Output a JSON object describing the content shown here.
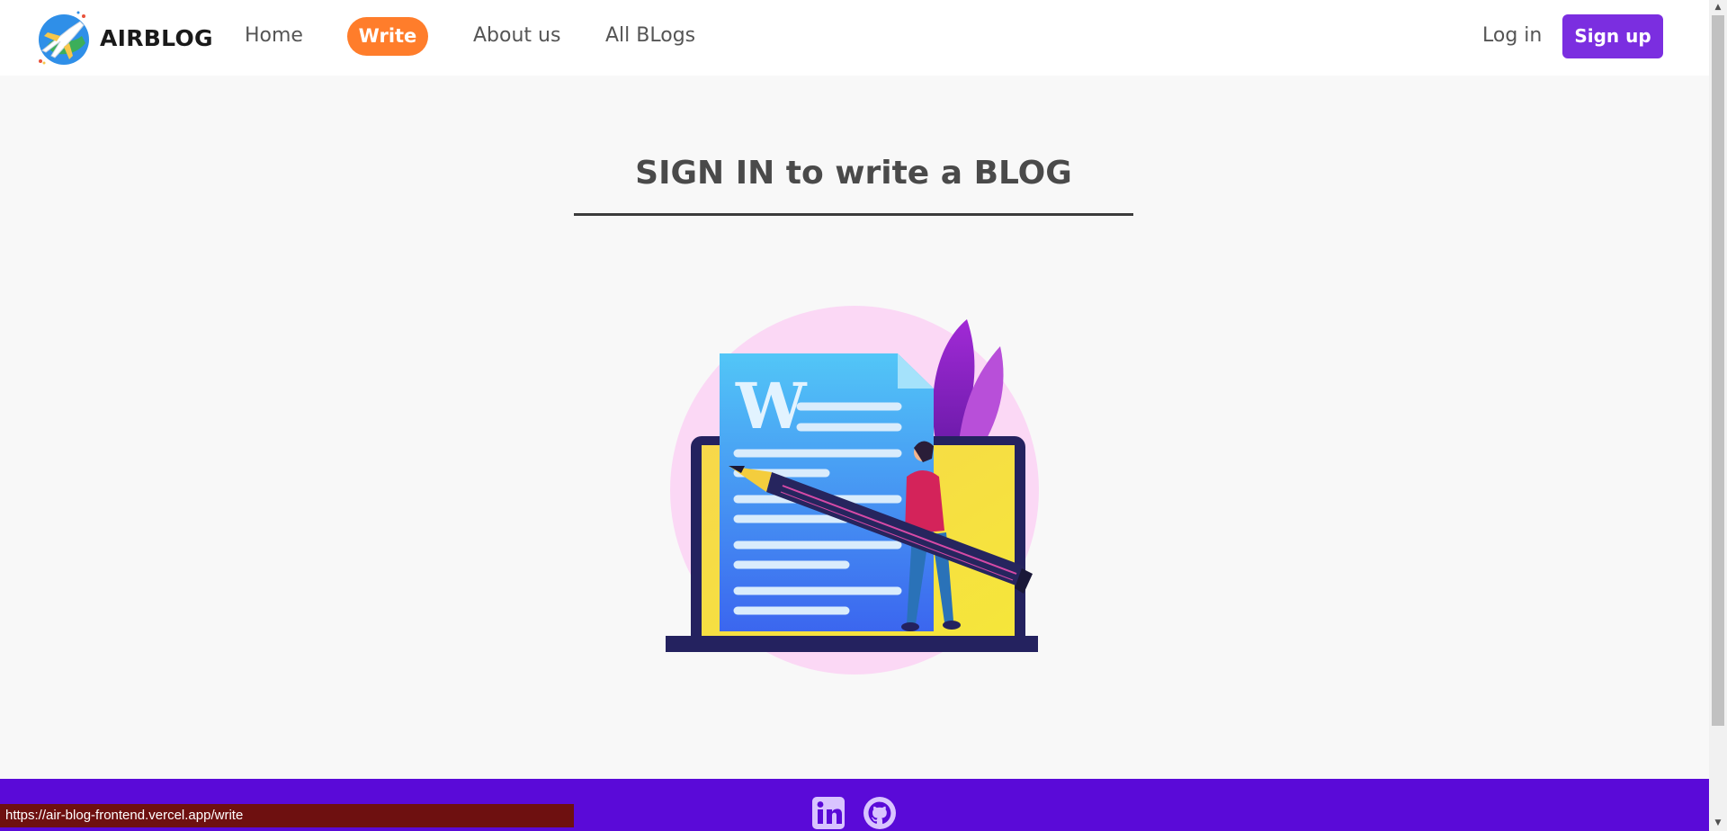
{
  "brand": {
    "name": "AIRBLOG",
    "logo_icon": "airplane-globe-icon"
  },
  "nav": {
    "home": "Home",
    "write": "Write",
    "about": "About us",
    "all_blogs": "All BLogs",
    "login": "Log in",
    "signup": "Sign up"
  },
  "main": {
    "heading": "SIGN IN to write a BLOG",
    "illustration": "writing-document-illustration"
  },
  "footer": {
    "icons": [
      "linkedin-icon",
      "github-icon"
    ]
  },
  "status_bar": {
    "url": "https://air-blog-frontend.vercel.app/write"
  },
  "colors": {
    "write_accent": "#ff7d2b",
    "signup_accent": "#7b2ee0",
    "footer_bg": "#5a0ad8",
    "page_bg": "#f8f8f8"
  }
}
